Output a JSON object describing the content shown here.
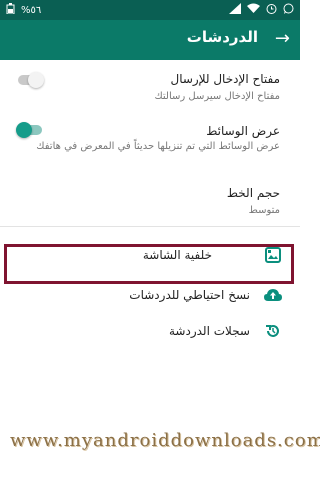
{
  "status_bar": {
    "battery": "%٥٦",
    "icons": [
      "battery-icon",
      "signal-icon",
      "wifi-icon",
      "alarm-icon",
      "whatsapp-icon"
    ]
  },
  "app_bar": {
    "title": "الدردشات",
    "back_icon": "arrow-right-icon"
  },
  "settings": {
    "enter_key": {
      "title": "مفتاح الإدخال للإرسال",
      "subtitle": "مفتاح الإدخال سيرسل رسالتك",
      "enabled": false
    },
    "media_visibility": {
      "title": "عرض الوسائط",
      "subtitle": "عرض الوسائط التي تم تنزيلها حديثاً في المعرض في هاتفك",
      "enabled": true
    },
    "font_size": {
      "title": "حجم الخط",
      "value": "متوسط"
    },
    "wallpaper": {
      "label": "خلفية الشاشة"
    },
    "backup": {
      "label": "نسخ احتياطي للدردشات"
    },
    "history": {
      "label": "سجلات الدردشة"
    }
  },
  "watermark": "www.myandroiddownloads.com",
  "colors": {
    "header": "#0b7a68",
    "accent": "#159c8a",
    "highlight": "#7f1430"
  }
}
